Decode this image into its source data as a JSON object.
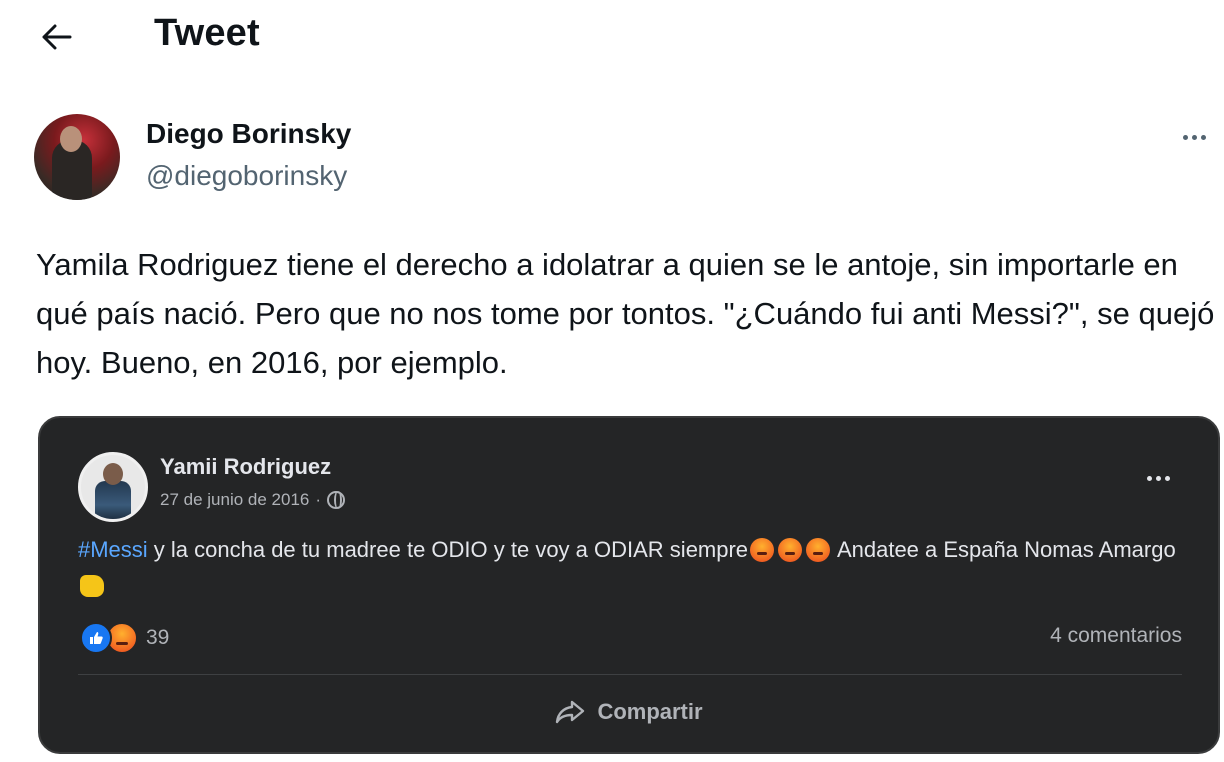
{
  "header": {
    "title": "Tweet",
    "back_icon": "arrow-left-icon"
  },
  "author": {
    "display_name": "Diego Borinsky",
    "handle": "@diegoborinsky",
    "more_icon": "more-horizontal-icon"
  },
  "tweet": {
    "text": "Yamila Rodriguez tiene el derecho a idolatrar a quien se le antoje, sin importarle en qué país nació. Pero que no nos tome por tontos. \"¿Cuándo fui anti Messi?\", se quejó hoy. Bueno, en 2016, por ejemplo."
  },
  "embedded_post": {
    "author_name": "Yamii Rodriguez",
    "date": "27 de junio de 2016",
    "separator": "·",
    "privacy_icon": "globe-icon",
    "hashtag": "#Messi",
    "text_part1": " y la concha de tu madree te ODIO y te voy a ODIAR siempre",
    "text_part2": " Andatee a España Nomas Amargo",
    "reaction_icons": [
      "like-icon",
      "angry-icon"
    ],
    "reaction_count": "39",
    "comments": "4 comentarios",
    "share_label": "Compartir",
    "share_icon": "share-arrow-icon",
    "background": "#242526",
    "hashtag_color": "#5aa7ff"
  }
}
